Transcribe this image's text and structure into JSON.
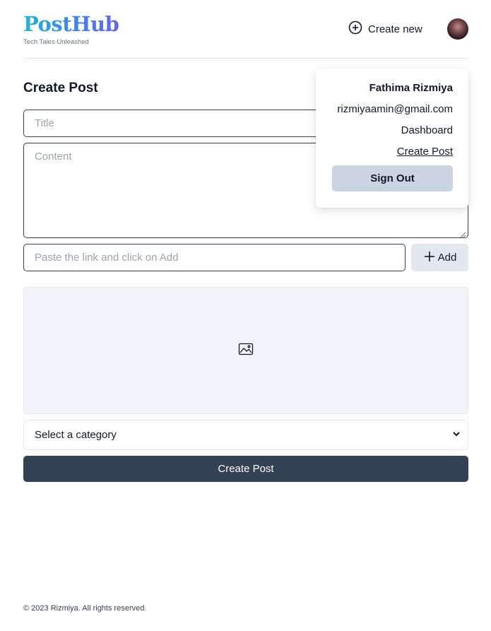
{
  "header": {
    "logo_text": "PostHub",
    "tagline": "Tech Tales Unleashed",
    "create_new_label": "Create new",
    "create_new_icon": "plus-circle-icon"
  },
  "form": {
    "heading": "Create Post",
    "title_placeholder": "Title",
    "content_placeholder": "Content",
    "link_placeholder": "Paste the link and click on Add",
    "add_label": "Add",
    "image_icon": "image-icon",
    "category_selected": "Select a category",
    "submit_label": "Create Post"
  },
  "user_menu": {
    "name": "Fathima Rizmiya",
    "email": "rizmiyaamin@gmail.com",
    "dashboard_label": "Dashboard",
    "create_post_label": "Create Post",
    "sign_out_label": "Sign Out"
  },
  "footer": {
    "copyright": "© 2023 Rizmiya. All rights reserved."
  },
  "colors": {
    "primary_button": "#334155",
    "add_button": "#e2e8f0",
    "sign_out_button": "#cbd5e1",
    "image_placeholder_bg": "#f1f5f9",
    "logo_gradient_start": "#22b5d4",
    "logo_gradient_end": "#6366f1"
  }
}
